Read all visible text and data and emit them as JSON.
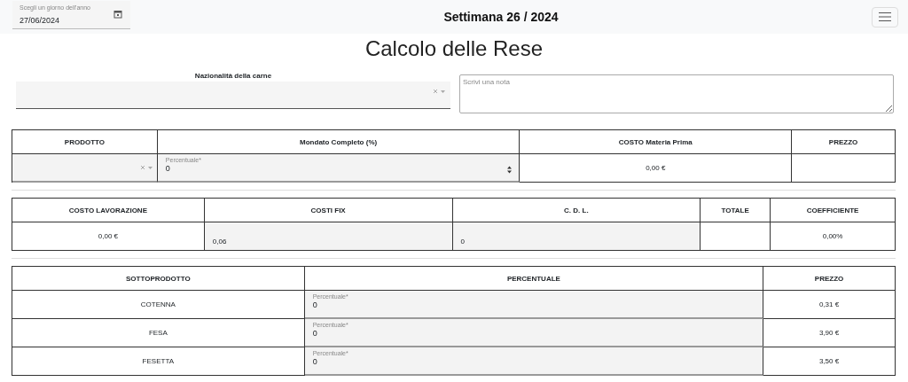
{
  "header": {
    "date_field": {
      "label": "Scegli un giorno dell'anno",
      "value": "27/06/2024"
    },
    "week_title": "Settimana 26 / 2024"
  },
  "page_title": "Calcolo delle Rese",
  "nationality": {
    "label": "Nazionalità della carne"
  },
  "note": {
    "placeholder": "Scrivi una nota"
  },
  "tables": [
    {
      "columns": [
        "PRODOTTO",
        "Mondato Completo (%)",
        "COSTO Materia Prima",
        "PREZZO"
      ],
      "rows": [
        [
          {
            "kind": "select"
          },
          {
            "kind": "field",
            "label": "Percentuale*",
            "value": "0",
            "spinner": true
          },
          {
            "kind": "text",
            "text": "0,00 €"
          },
          {
            "kind": "empty"
          }
        ]
      ]
    },
    {
      "columns": [
        "COSTO LAVORAZIONE",
        "COSTI FIX",
        "C. D. L.",
        "TOTALE",
        "COEFFICIENTE"
      ],
      "rows": [
        [
          {
            "kind": "text",
            "text": "0,00 €"
          },
          {
            "kind": "readonly",
            "value": "0,06"
          },
          {
            "kind": "readonly",
            "value": "0"
          },
          {
            "kind": "empty"
          },
          {
            "kind": "text",
            "text": "0,00%"
          }
        ]
      ]
    },
    {
      "columns": [
        "SOTTOPRODOTTO",
        "PERCENTUALE",
        "PREZZO"
      ],
      "rows": [
        [
          {
            "kind": "text",
            "text": "COTENNA"
          },
          {
            "kind": "field",
            "label": "Percentuale*",
            "value": "0",
            "spinner": false
          },
          {
            "kind": "text",
            "text": "0,31 €"
          }
        ],
        [
          {
            "kind": "text",
            "text": "FESA"
          },
          {
            "kind": "field",
            "label": "Percentuale*",
            "value": "0",
            "spinner": false
          },
          {
            "kind": "text",
            "text": "3,90 €"
          }
        ],
        [
          {
            "kind": "text",
            "text": "FESETTA"
          },
          {
            "kind": "field",
            "label": "Percentuale*",
            "value": "0",
            "spinner": false
          },
          {
            "kind": "text",
            "text": "3,50 €"
          }
        ]
      ]
    }
  ]
}
